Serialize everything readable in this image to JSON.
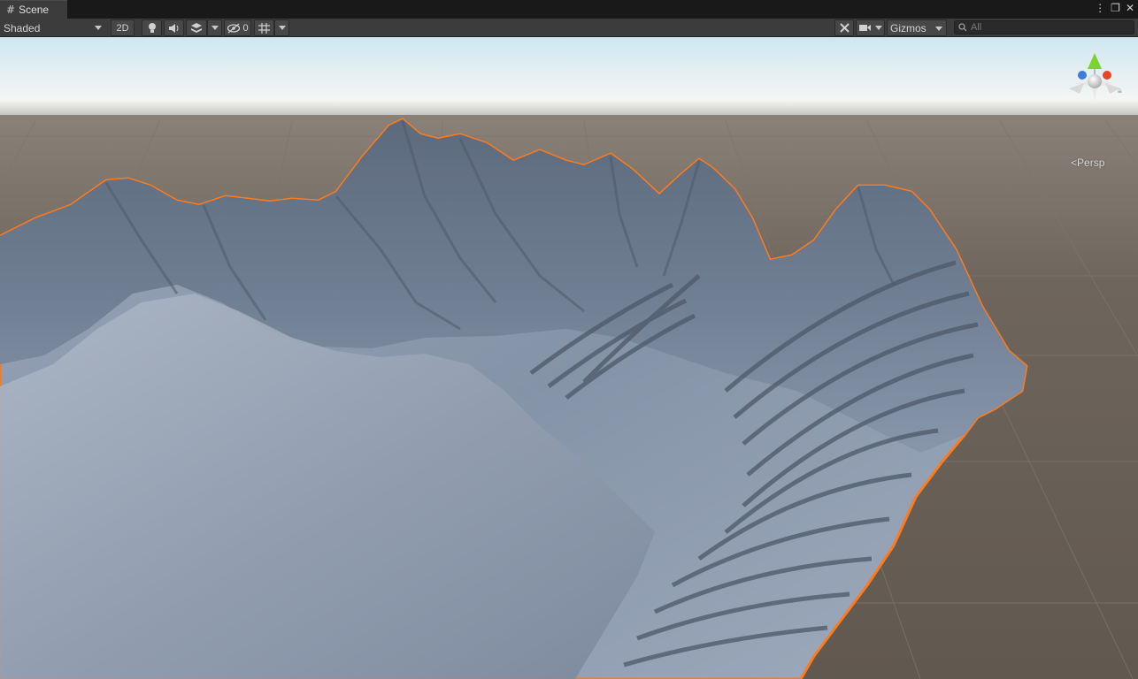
{
  "window": {
    "tab_title": "Scene",
    "tab_icon": "hash-icon"
  },
  "toolbar": {
    "draw_mode": "Shaded",
    "two_d_label": "2D",
    "hidden_count": "0",
    "gizmos_label": "Gizmos",
    "search_placeholder": "All",
    "icons": [
      "lighting-icon",
      "audio-icon",
      "effects-icon",
      "visibility-icon",
      "grid-icon",
      "tools-icon",
      "camera-icon",
      "search-icon"
    ]
  },
  "viewport": {
    "projection_label": "Persp",
    "selection_outline_color": "#ff7a1a",
    "sky_color": "#ffffff",
    "ground_color": "#6e655d",
    "terrain_color": "#8e9bb0"
  },
  "gizmo": {
    "axis_colors": {
      "x": "#e8442c",
      "y": "#7bd42c",
      "z": "#3f7bdc"
    }
  }
}
